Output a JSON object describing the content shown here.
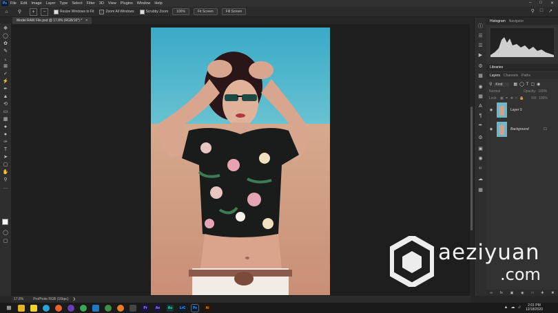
{
  "app": {
    "logo": "Ps",
    "document_tab": "Model RAW File.psd @ 17.8% (RGB/16*) *"
  },
  "menu": [
    "File",
    "Edit",
    "Image",
    "Layer",
    "Type",
    "Select",
    "Filter",
    "3D",
    "View",
    "Plugins",
    "Window",
    "Help"
  ],
  "options": {
    "resize_windows": "Resize Windows to Fit",
    "zoom_all": "Zoom All Windows",
    "scrubby_zoom": "Scrubby Zoom",
    "zoom_value": "100%",
    "fit_screen": "Fit Screen",
    "fill_screen": "Fill Screen"
  },
  "panels": {
    "top_tabs": [
      "Histogram",
      "Navigator"
    ],
    "libraries": "Libraries",
    "layer_tabs": [
      "Layers",
      "Channels",
      "Paths"
    ],
    "kind": "Kind",
    "blend": "Normal",
    "opacity_label": "Opacity:",
    "opacity": "100%",
    "lock_label": "Lock:",
    "fill_label": "Fill:",
    "fill": "100%",
    "layers": [
      {
        "name": "Layer 0"
      },
      {
        "name": "Background"
      }
    ]
  },
  "status": {
    "zoom": "17.8%",
    "info": "ProPhoto RGB (16bpc)"
  },
  "taskbar": {
    "time": "2:01 PM",
    "date": "12/18/2020"
  },
  "watermark": {
    "line1": "aeziyuan",
    "line2": ".com"
  },
  "colors": {
    "accent": "#31a8ff",
    "sky": "#4fb3c9",
    "sand": "#d9a48a",
    "canvas_bg": "#1e1e1e"
  },
  "icons": [
    "home-icon",
    "zoom-icon",
    "zoom-in-icon",
    "zoom-out-icon",
    "move-icon",
    "marquee-icon",
    "lasso-icon",
    "crop-icon",
    "eyedropper-icon",
    "brush-icon",
    "eraser-icon",
    "text-icon",
    "hand-icon",
    "eye-icon",
    "lock-icon",
    "trash-icon"
  ]
}
